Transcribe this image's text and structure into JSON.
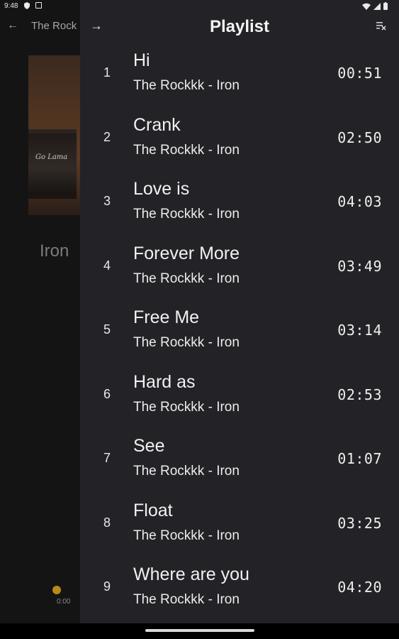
{
  "status_bar": {
    "time": "9:48"
  },
  "background": {
    "back_arrow": "←",
    "title": "The Rock",
    "song_title": "Iron",
    "amp_logo": "Go Lama",
    "elapsed": "0:00"
  },
  "playlist": {
    "back_arrow": "→",
    "title": "Playlist",
    "clear_icon": "clear-queue-icon",
    "items": [
      {
        "num": "1",
        "title": "Hi",
        "subtitle": "The Rockkk - Iron",
        "duration": "00:51"
      },
      {
        "num": "2",
        "title": "Crank",
        "subtitle": "The Rockkk - Iron",
        "duration": "02:50"
      },
      {
        "num": "3",
        "title": "Love is",
        "subtitle": "The Rockkk - Iron",
        "duration": "04:03"
      },
      {
        "num": "4",
        "title": "Forever More",
        "subtitle": "The Rockkk - Iron",
        "duration": "03:49"
      },
      {
        "num": "5",
        "title": "Free Me",
        "subtitle": "The Rockkk - Iron",
        "duration": "03:14"
      },
      {
        "num": "6",
        "title": "Hard as",
        "subtitle": "The Rockkk - Iron",
        "duration": "02:53"
      },
      {
        "num": "7",
        "title": "See",
        "subtitle": "The Rockkk - Iron",
        "duration": "01:07"
      },
      {
        "num": "8",
        "title": "Float",
        "subtitle": "The Rockkk - Iron",
        "duration": "03:25"
      },
      {
        "num": "9",
        "title": "Where are you",
        "subtitle": "The Rockkk - Iron",
        "duration": "04:20"
      }
    ]
  },
  "colors": {
    "drawer_bg": "#232327",
    "accent": "#b88a1a",
    "screen_bg": "#141415"
  }
}
